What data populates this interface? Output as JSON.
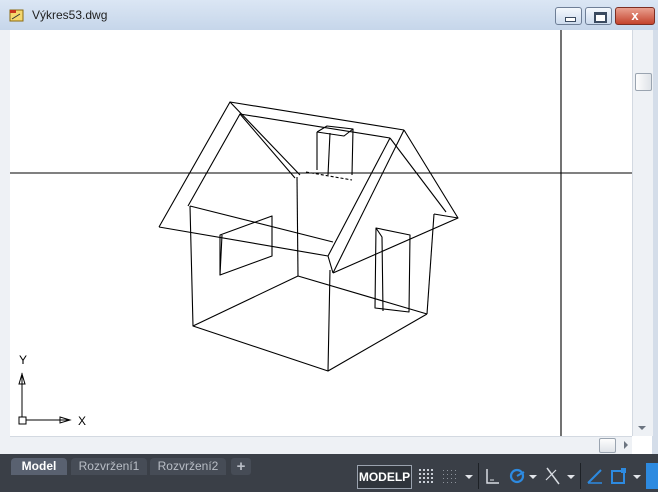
{
  "window": {
    "title": "Výkres53.dwg",
    "buttons": {
      "close_glyph": "x"
    }
  },
  "canvas": {
    "ucs_y_label": "Y",
    "ucs_x_label": "X"
  },
  "layout_tabs": [
    {
      "label": "Model",
      "active": true
    },
    {
      "label": "Rozvržení1",
      "active": false
    },
    {
      "label": "Rozvržení2",
      "active": false
    }
  ],
  "add_tab_label": "+",
  "status": {
    "space_label": "MODELP"
  },
  "icons": {
    "app": "dwg-file-icon",
    "grid": "grid-icon",
    "snap": "snap-icon",
    "ortho": "ortho-icon",
    "polar": "polar-tracking-icon",
    "isodraft": "isodraft-icon",
    "lineweight": "lineweight-icon",
    "annotation": "annotation-icon"
  },
  "colors": {
    "accent": "#2d8ae0",
    "status_bg": "#3a3f47",
    "titlebar": "#c6d6ea"
  }
}
